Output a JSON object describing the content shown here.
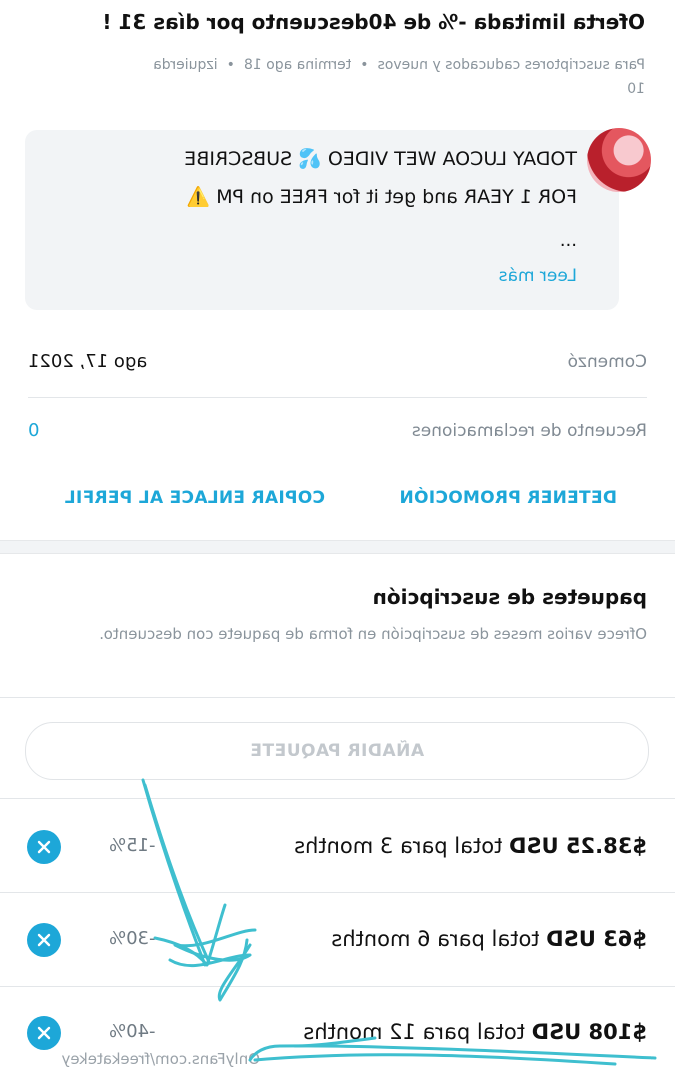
{
  "offer": {
    "title": "Oferta limitada -% de 40descuento por días 31 !",
    "audience": "Para suscriptores caducados y nuevos",
    "ends": "termina ago 18",
    "left_label": "izquierda",
    "left_count": "10"
  },
  "message": {
    "line1": "TODAY LUCOA WET VIDEO 💦 SUBSCRIBE",
    "line2": "FOR 1 YEAR and get it for FREE on PM ⚠️",
    "ellipsis": "...",
    "read_more": "Leer más"
  },
  "started": {
    "label": "Comenzó",
    "value": "ago 17, 2021"
  },
  "claims": {
    "label": "Recuento de reclamaciones",
    "value": "0"
  },
  "actions": {
    "stop": "DETENER PROMOCIÓN",
    "copy": "COPIAR ENLACE AL PERFIL"
  },
  "packages": {
    "title": "paquetes de suscripción",
    "description": "Ofrece varios meses de suscripción en forma de paquete con descuento.",
    "add_button": "AÑADIR PAQUETE",
    "items": [
      {
        "price": "$38.25 USD",
        "text": "total para 3 months",
        "discount": "-15%"
      },
      {
        "price": "$63 USD",
        "text": "total para 6 months",
        "discount": "-30%"
      },
      {
        "price": "$108 USD",
        "text": "total para 12 months",
        "discount": "-40%"
      }
    ]
  },
  "watermark": "OnlyFans.com/freekatekey",
  "colors": {
    "accent": "#1da7d8",
    "muted": "#8a949c",
    "scribble": "#3fbfcf"
  },
  "icons": [
    "avatar",
    "remove-x-icon",
    "scribble-arrow"
  ]
}
